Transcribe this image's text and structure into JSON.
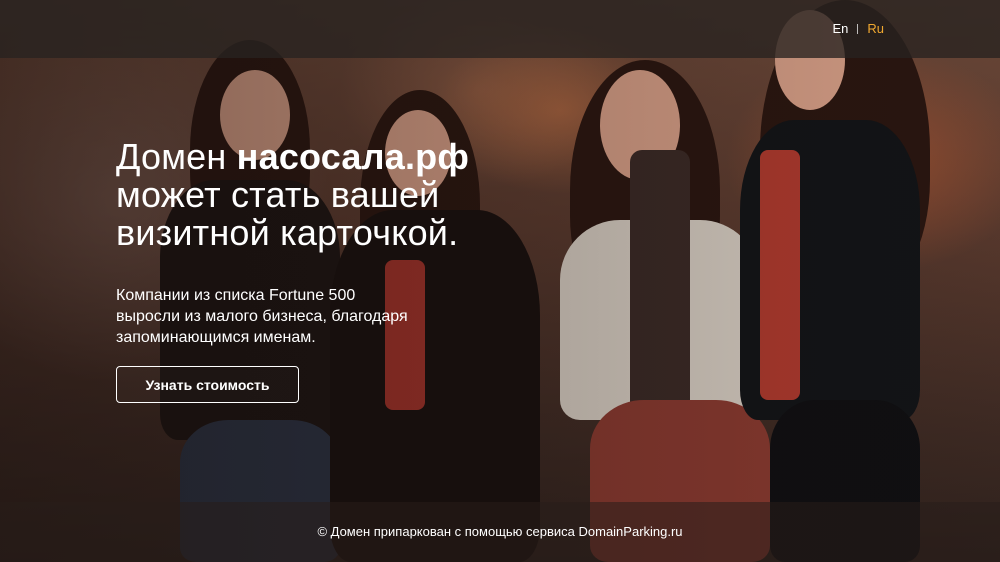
{
  "header": {
    "languages": [
      {
        "label": "En",
        "active": false
      },
      {
        "label": "Ru",
        "active": true
      }
    ],
    "active_color": "#f0a830"
  },
  "hero": {
    "headline_prefix": "Домен ",
    "domain": "насосала.рф",
    "headline_line2": "может стать вашей",
    "headline_line3": "визитной карточкой.",
    "subtext_line1": "Компании из списка Fortune 500",
    "subtext_line2": "выросли из малого бизнеса, благодаря",
    "subtext_line3": "запоминающимся именам.",
    "cta_label": "Узнать стоимость"
  },
  "footer": {
    "text": "© Домен припаркован с помощью сервиса DomainParking.ru"
  }
}
